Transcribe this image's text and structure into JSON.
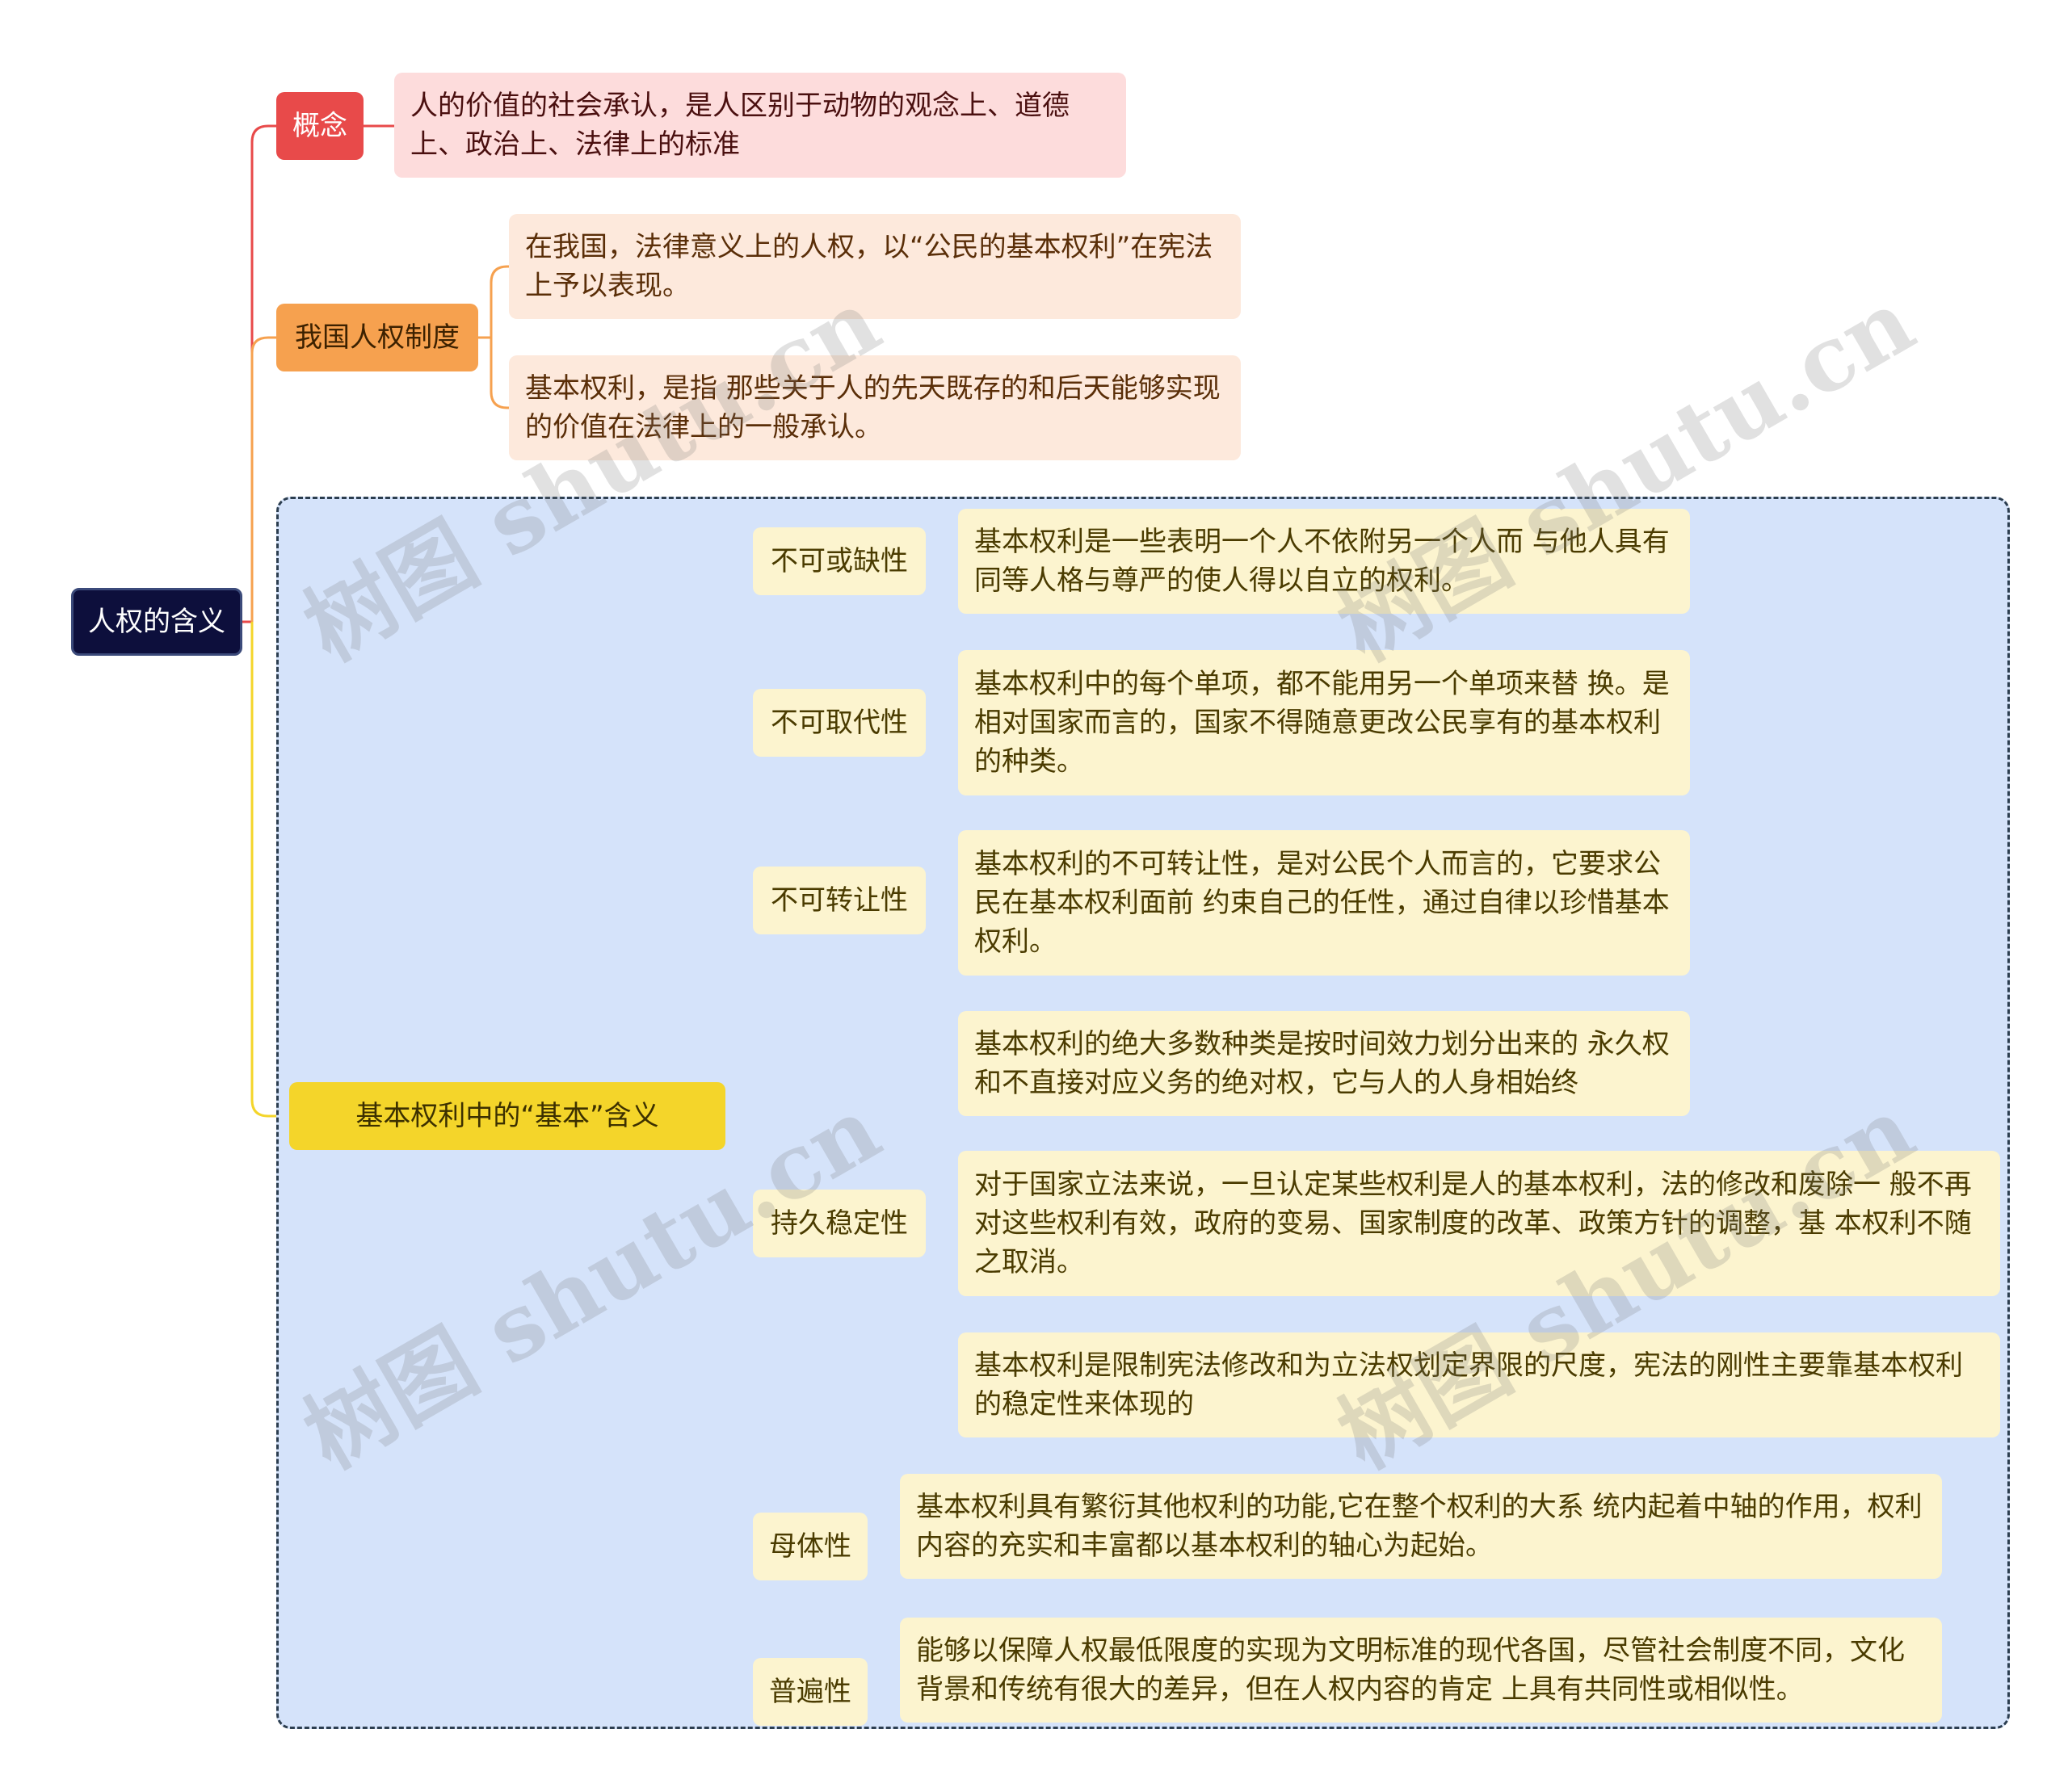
{
  "root": {
    "label": "人权的含义"
  },
  "concept": {
    "label": "概念",
    "text": "人的价值的社会承认，是人区别于动物的观念上、道德上、政治上、法律上的标准"
  },
  "system": {
    "label": "我国人权制度",
    "texts": [
      "在我国，法律意义上的人权，以“公民的基本权利”在宪法上予以表现。",
      "基本权利，是指 那些关于人的先天既存的和后天能够实现的价值在法律上的一般承认。"
    ]
  },
  "basic": {
    "label": "基本权利中的“基本”含义",
    "features": [
      {
        "label": "不可或缺性",
        "items": [
          "基本权利是一些表明一个人不依附另一个人而 与他人具有同等人格与尊严的使人得以自立的权利。"
        ]
      },
      {
        "label": "不可取代性",
        "items": [
          "基本权利中的每个单项，都不能用另一个单项来替 换。是相对国家而言的，国家不得随意更改公民享有的基本权利的种类。"
        ]
      },
      {
        "label": "不可转让性",
        "items": [
          "基本权利的不可转让性，是对公民个人而言的，它要求公民在基本权利面前 约束自己的任性，通过自律以珍惜基本权利。"
        ]
      },
      {
        "label": "持久稳定性",
        "items": [
          "基本权利的绝大多数种类是按时间效力划分出来的 永久权和不直接对应义务的绝对权，它与人的人身相始终",
          "对于国家立法来说，一旦认定某些权利是人的基本权利，法的修改和废除一 般不再对这些权利有效，政府的变易、国家制度的改革、政策方针的调整，基 本权利不随之取消。",
          "基本权利是限制宪法修改和为立法权划定界限的尺度，宪法的刚性主要靠基本权利的稳定性来体现的"
        ]
      },
      {
        "label": "母体性",
        "items": [
          "基本权利具有繁衍其他权利的功能,它在整个权利的大系 统内起着中轴的作用，权利内容的充实和丰富都以基本权利的轴心为起始。"
        ]
      },
      {
        "label": "普遍性",
        "items": [
          "能够以保障人权最低限度的实现为文明标准的现代各国，尽管社会制度不同，文化背景和传统有很大的差异，但在人权内容的肯定 上具有共同性或相似性。"
        ]
      }
    ]
  },
  "watermark": "树图 shutu.cn",
  "colors": {
    "concept_line": "#e84a4a",
    "system_line": "#f6a14f",
    "basic_line": "#f4d52a"
  }
}
